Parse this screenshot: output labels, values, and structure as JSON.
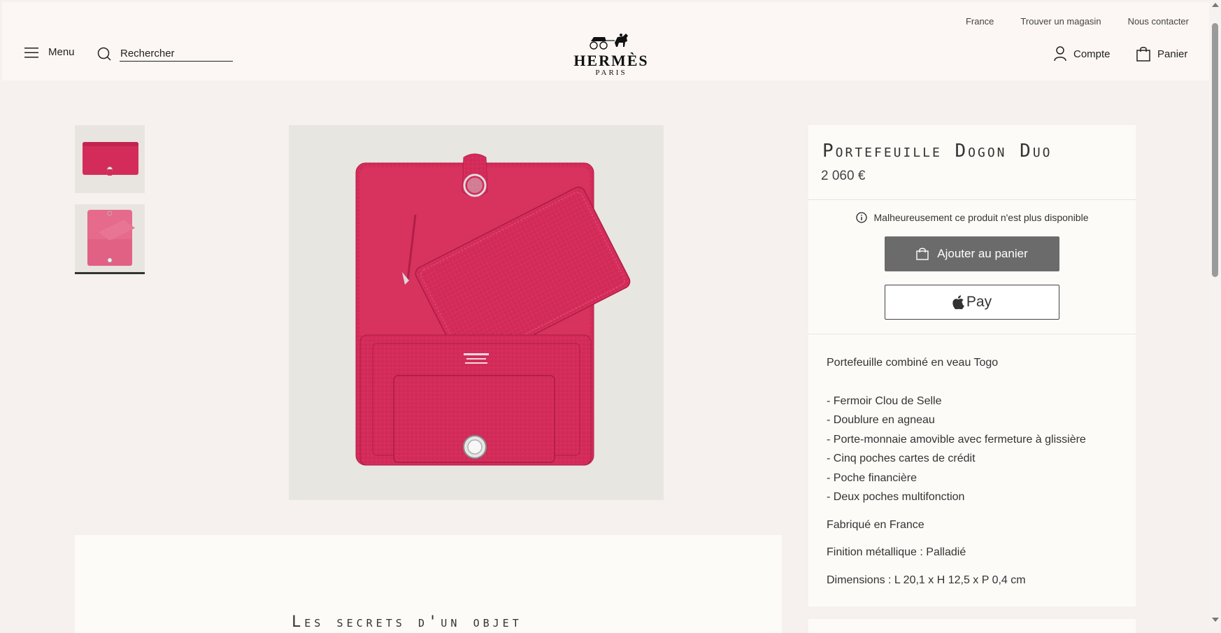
{
  "header": {
    "top_links": [
      "France",
      "Trouver un magasin",
      "Nous contacter"
    ],
    "menu_label": "Menu",
    "search_placeholder": "Rechercher",
    "logo_name": "HERMÈS",
    "logo_city": "PARIS",
    "account_label": "Compte",
    "cart_label": "Panier"
  },
  "product": {
    "name": "Portefeuille Dogon Duo",
    "price": "2 060 €",
    "availability": "Malheureusement ce produit n'est plus disponible",
    "add_to_cart_label": "Ajouter au panier",
    "apple_pay_label": "Pay",
    "description_intro": "Portefeuille combiné en veau Togo",
    "features": [
      "- Fermoir Clou de Selle",
      "- Doublure en agneau",
      "- Porte-monnaie amovible avec fermeture à glissière",
      "- Cinq poches cartes de crédit",
      "- Poche financière",
      "- Deux poches multifonction"
    ],
    "made_in": "Fabriqué en France",
    "finish": "Finition métallique : Palladié",
    "dimensions": "Dimensions : L 20,1 x H 12,5 x P 0,4 cm",
    "color": "#d42c5a"
  },
  "story": {
    "title": "Les secrets d'un objet"
  },
  "colors": {
    "page_bg": "#f6f1ee",
    "header_bg": "#fcf7f4",
    "button_gray": "#6b6b6b",
    "wallet_red": "#d42c5a",
    "wallet_pink": "#e56a8c"
  }
}
